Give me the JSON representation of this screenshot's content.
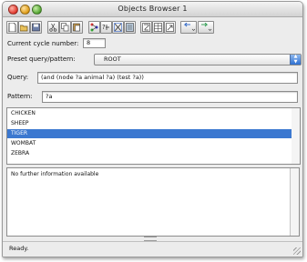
{
  "window": {
    "title": "Objects Browser 1"
  },
  "toolbar": {
    "buttons": [
      {
        "name": "new-icon"
      },
      {
        "name": "open-icon"
      },
      {
        "name": "save-icon"
      },
      {
        "name": "cut-icon"
      },
      {
        "name": "copy-icon"
      },
      {
        "name": "paste-icon"
      },
      {
        "name": "network-icon"
      },
      {
        "name": "relation-icon"
      },
      {
        "name": "tree-icon"
      },
      {
        "name": "graph-icon"
      },
      {
        "name": "query-icon"
      },
      {
        "name": "table-icon"
      },
      {
        "name": "export-icon"
      },
      {
        "name": "back-arrow-icon"
      },
      {
        "name": "forward-arrow-icon"
      }
    ]
  },
  "cycle": {
    "label": "Current cycle number:",
    "value": "8"
  },
  "preset": {
    "label": "Preset query/pattern:",
    "selected": "ROOT"
  },
  "query": {
    "label": "Query:",
    "value": "(and (node ?a animal ?a) (test ?a))"
  },
  "pattern": {
    "label": "Pattern:",
    "value": "?a"
  },
  "results": {
    "items": [
      "CHICKEN",
      "SHEEP",
      "TIGER",
      "WOMBAT",
      "ZEBRA"
    ],
    "selected_index": 2
  },
  "info": {
    "text": "No further information available"
  },
  "status": {
    "text": "Ready."
  },
  "colors": {
    "selection": "#3b78d0",
    "accent": "#2e6fd0"
  }
}
